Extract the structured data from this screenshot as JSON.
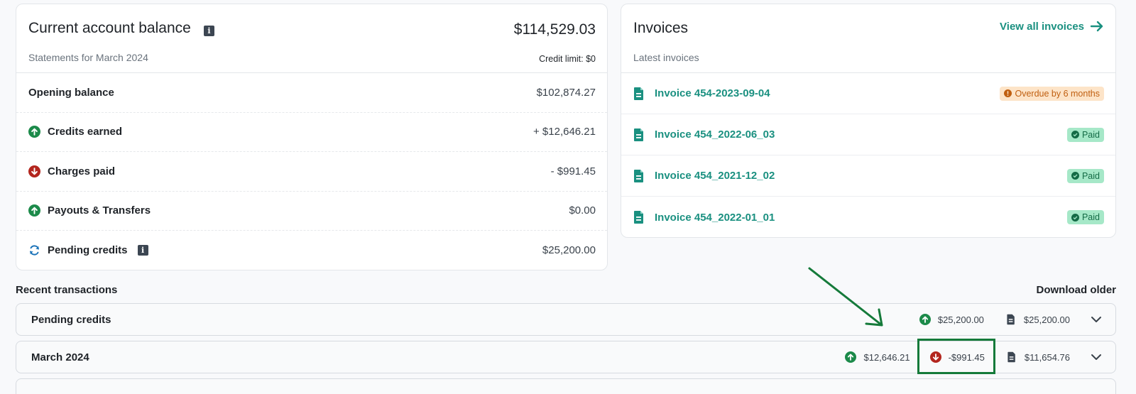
{
  "balance": {
    "title": "Current account balance",
    "amount": "$114,529.03",
    "subtitle": "Statements for March 2024",
    "credit_limit": "Credit limit: $0",
    "rows": [
      {
        "label": "Opening balance",
        "value": "$102,874.27",
        "icon": "none"
      },
      {
        "label": "Credits earned",
        "value": "+ $12,646.21",
        "icon": "arrow-up-circle-icon"
      },
      {
        "label": "Charges paid",
        "value": "- $991.45",
        "icon": "arrow-down-circle-icon"
      },
      {
        "label": "Payouts & Transfers",
        "value": "$0.00",
        "icon": "arrow-up-circle-icon"
      },
      {
        "label": "Pending credits",
        "value": "$25,200.00",
        "icon": "refresh-icon"
      }
    ]
  },
  "invoices": {
    "title": "Invoices",
    "subtitle": "Latest invoices",
    "view_all": "View all invoices",
    "items": [
      {
        "name": "Invoice 454-2023-09-04",
        "status": "Overdue by 6 months"
      },
      {
        "name": "Invoice 454_2022-06_03",
        "status": "Paid"
      },
      {
        "name": "Invoice 454_2021-12_02",
        "status": "Paid"
      },
      {
        "name": "Invoice 454_2022-01_01",
        "status": "Paid"
      }
    ]
  },
  "transactions": {
    "title": "Recent transactions",
    "download_older": "Download older",
    "rows": [
      {
        "label": "Pending credits",
        "credits": "$25,200.00",
        "total": "$25,200.00"
      },
      {
        "label": "March 2024",
        "credits": "$12,646.21",
        "charges": "-$991.45",
        "total": "$11,654.76"
      }
    ]
  },
  "colors": {
    "accent": "#1a9080",
    "up": "#1c8a4a",
    "down": "#b3261e",
    "annotation": "#157a3a"
  }
}
